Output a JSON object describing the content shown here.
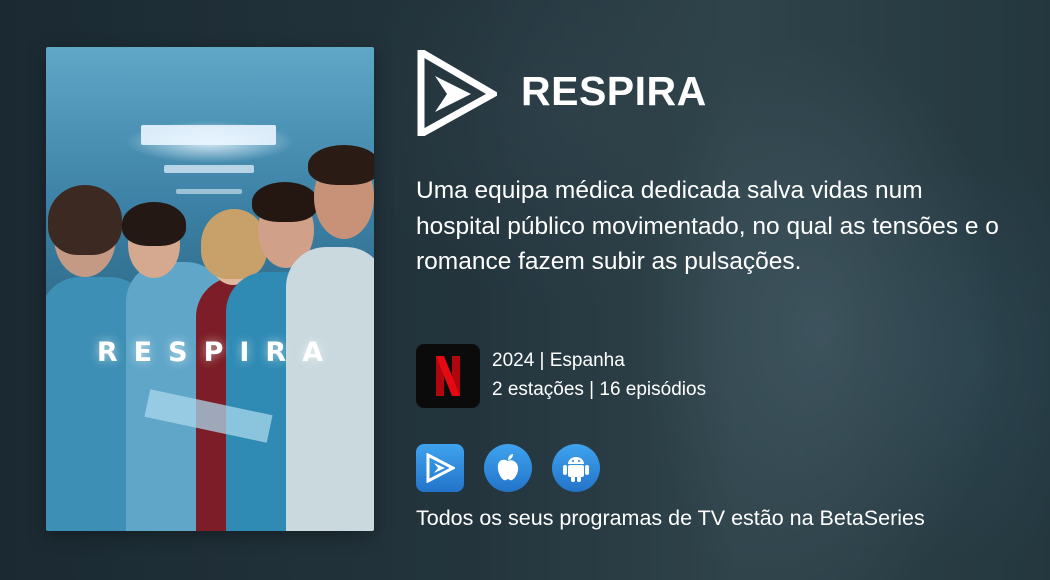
{
  "show": {
    "title": "RESPIRA",
    "poster_title": "RESPIRA",
    "description": "Uma equipa médica dedicada salva vidas num hospital público movimentado, no qual as tensões e o romance fazem subir as pulsações.",
    "year_country": "2024 | Espanha",
    "seasons_episodes": "2 estações | 16 episódios",
    "provider_icon": "netflix-logo-icon",
    "provider_letter": "N"
  },
  "apps": [
    {
      "name": "betaseries-app-icon"
    },
    {
      "name": "apple-app-icon"
    },
    {
      "name": "android-app-icon"
    }
  ],
  "footer": {
    "tagline": "Todos os seus programas de TV estão na BetaSeries"
  },
  "colors": {
    "accent_blue": "#2f8ee0",
    "netflix_red": "#e50914",
    "text": "#ffffff"
  }
}
